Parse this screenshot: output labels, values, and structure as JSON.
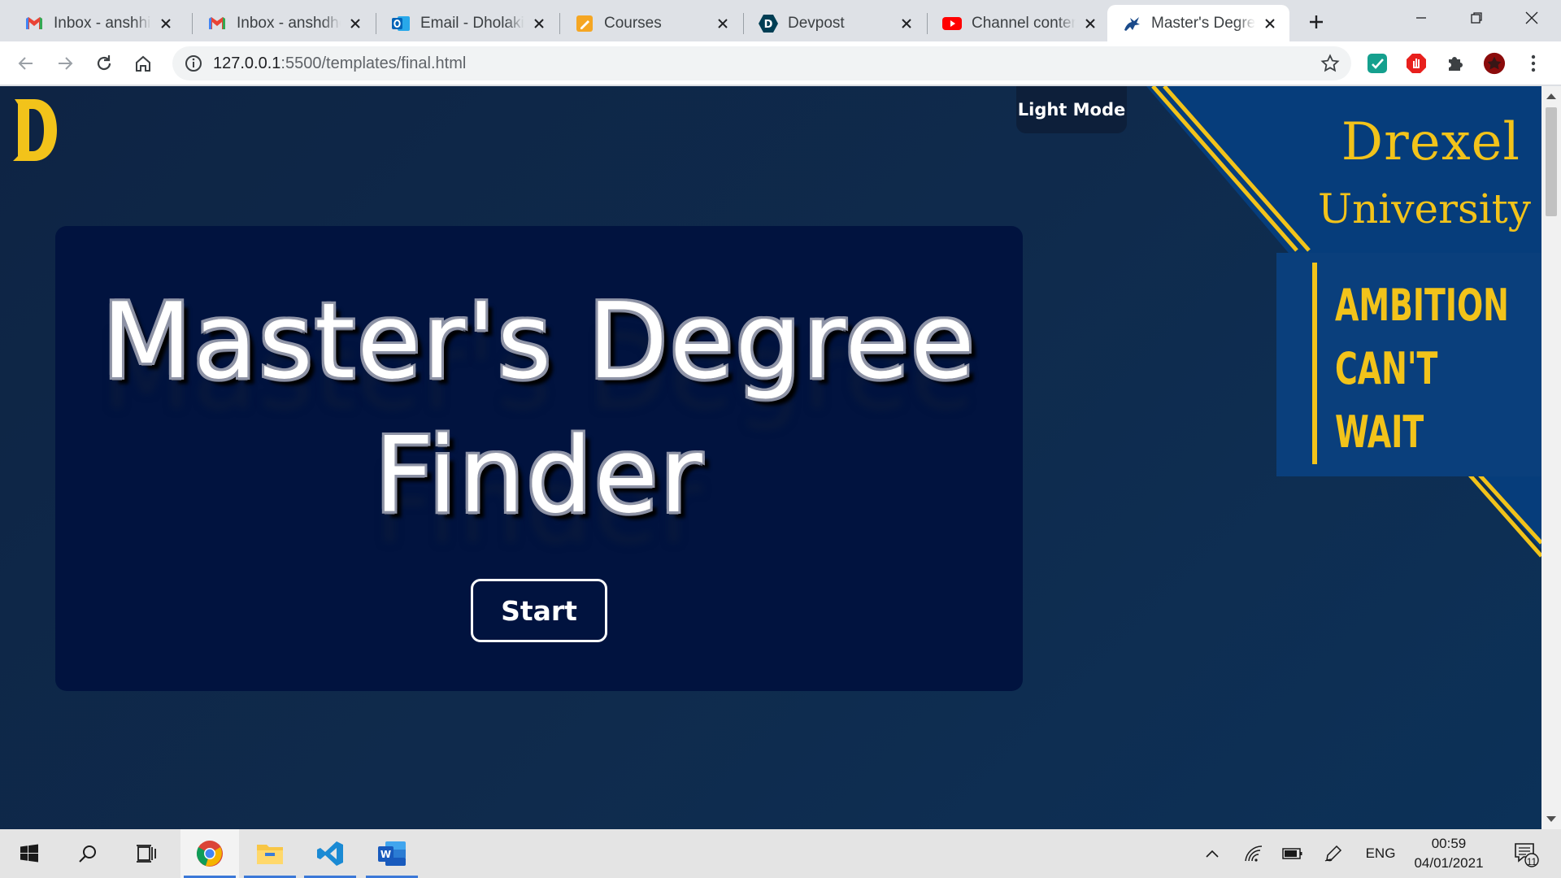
{
  "browser": {
    "tabs": [
      {
        "title": "Inbox - anshhiro",
        "favicon": "gmail-icon"
      },
      {
        "title": "Inbox - anshdhol",
        "favicon": "gmail-icon"
      },
      {
        "title": "Email - Dholakia",
        "favicon": "outlook-icon"
      },
      {
        "title": "Courses",
        "favicon": "courses-icon"
      },
      {
        "title": "Devpost",
        "favicon": "devpost-icon"
      },
      {
        "title": "Channel content",
        "favicon": "youtube-icon"
      },
      {
        "title": "Master's Degree",
        "favicon": "dragon-icon",
        "active": true
      }
    ],
    "url_host": "127.0.0.1",
    "url_rest": ":5500/templates/final.html"
  },
  "page": {
    "mode_toggle_label": "Light Mode",
    "logo_letter": "D",
    "hero_title_line1": "Master's Degree",
    "hero_title_line2": "Finder",
    "start_label": "Start",
    "brand_name": "Drexel",
    "brand_sub": "University",
    "slogan": [
      "AMBITION",
      "CAN'T",
      "WAIT"
    ]
  },
  "taskbar": {
    "language": "ENG",
    "time": "00:59",
    "date": "04/01/2021",
    "notification_count": "11"
  },
  "colors": {
    "gold": "#f2c31a",
    "navy": "#01133f",
    "drexel_blue": "#0a3f7c"
  }
}
